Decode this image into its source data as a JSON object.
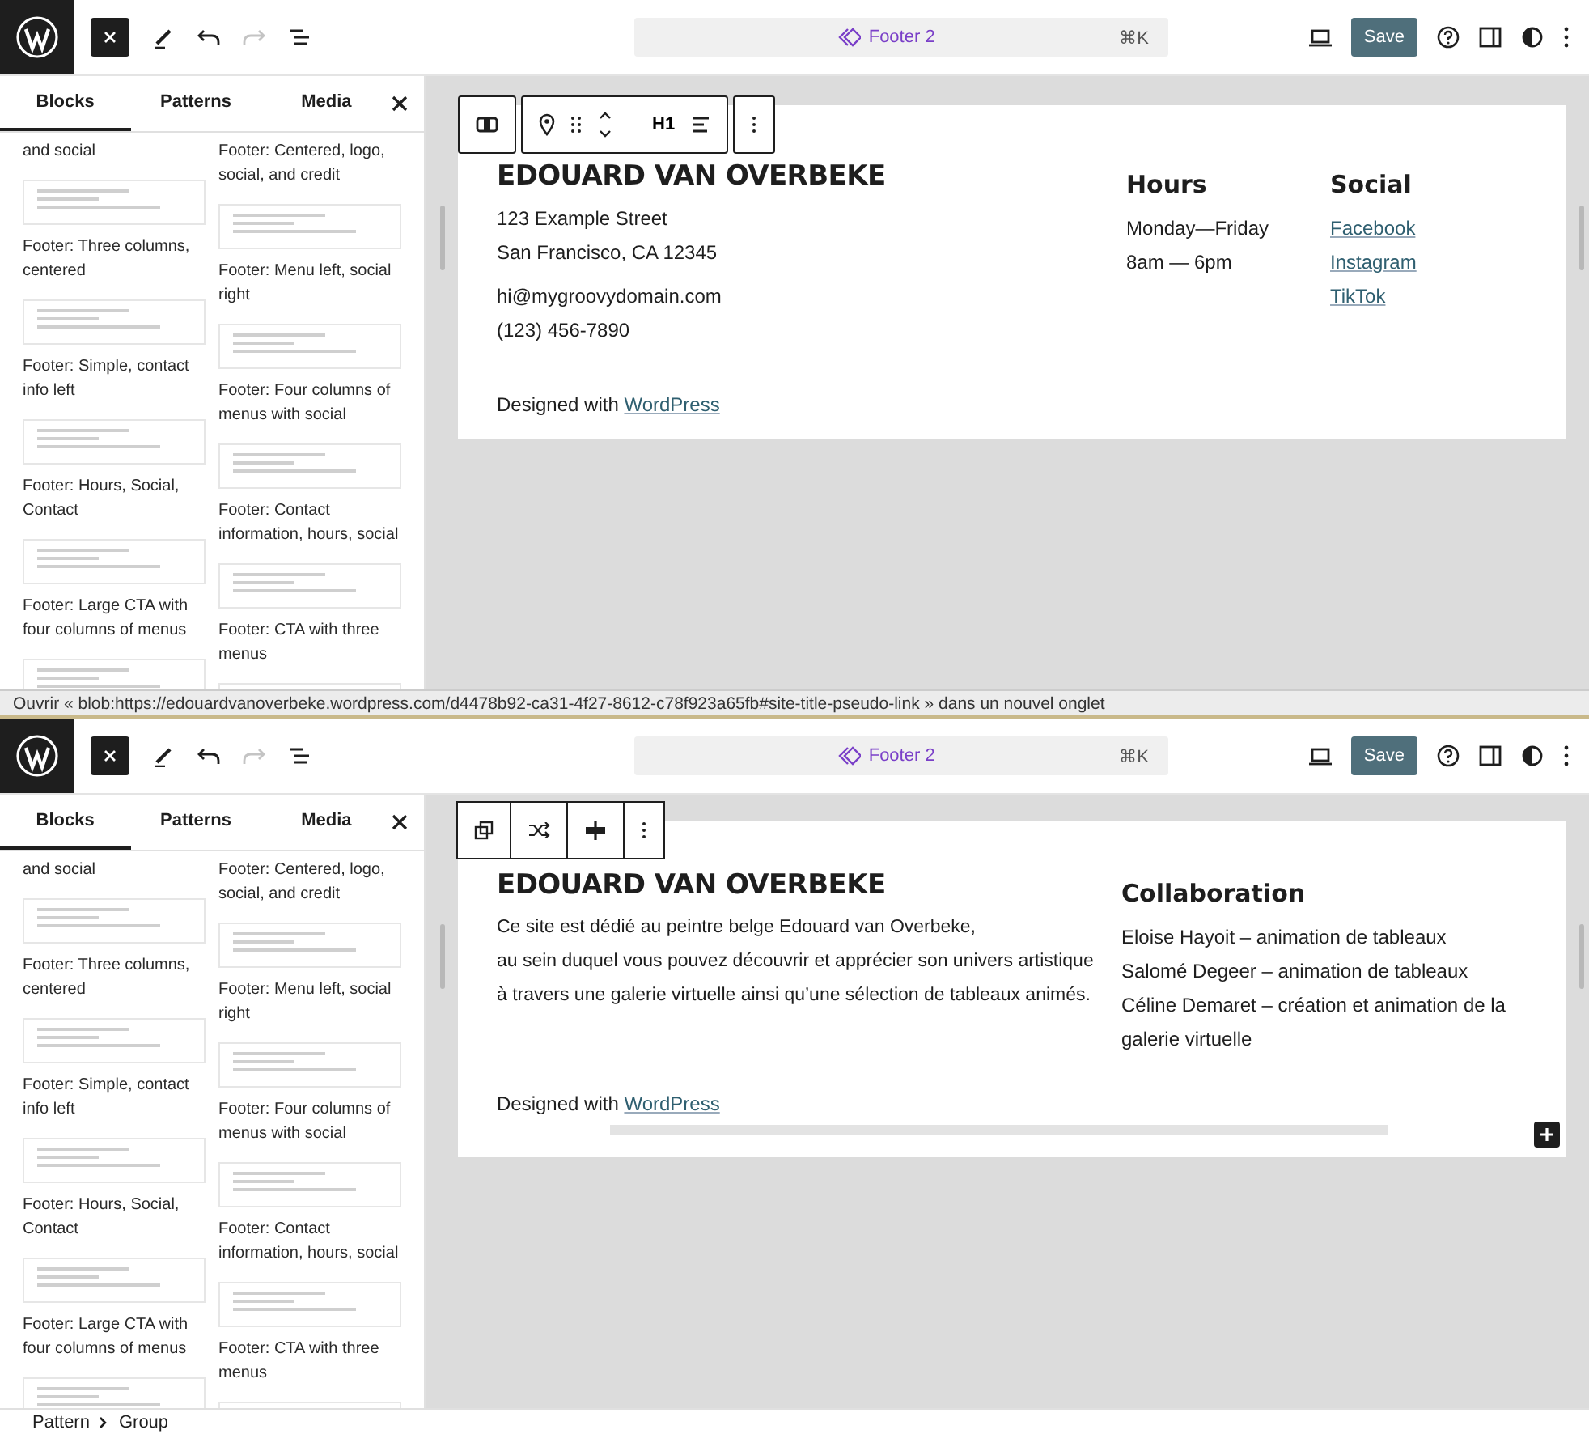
{
  "editors": [
    {
      "header": {
        "command_title": "Footer 2",
        "shortcut": "⌘K",
        "save": "Save",
        "redo_disabled": true
      },
      "inserter": {
        "tabs": [
          {
            "label": "Blocks",
            "selected": true
          },
          {
            "label": "Patterns",
            "selected": false
          },
          {
            "label": "Media",
            "selected": false
          }
        ],
        "columns": [
          [
            {
              "kind": "caption",
              "label": "and social"
            },
            {
              "kind": "pattern",
              "label": "Footer: Three columns, centered"
            },
            {
              "kind": "pattern",
              "label": "Footer: Simple, contact info left"
            },
            {
              "kind": "pattern",
              "label": "Footer: Hours, Social, Contact"
            },
            {
              "kind": "pattern",
              "label": "Footer: Large CTA with four columns of menus"
            },
            {
              "kind": "preview"
            }
          ],
          [
            {
              "kind": "caption",
              "label": "Footer: Centered, logo, social, and credit"
            },
            {
              "kind": "pattern",
              "label": "Footer: Menu left, social right"
            },
            {
              "kind": "pattern",
              "label": "Footer: Four columns of menus with social"
            },
            {
              "kind": "pattern",
              "label": "Footer: Contact information, hours, social"
            },
            {
              "kind": "pattern",
              "label": "Footer: CTA with three menus"
            },
            {
              "kind": "preview"
            }
          ]
        ]
      },
      "canvas": {
        "kind": "heading",
        "heading_level": "H1",
        "title": "EDOUARD VAN OVERBEKE",
        "left_groups": [
          [
            "123 Example Street",
            "San Francisco, CA 12345"
          ],
          [
            "hi@mygroovydomain.com",
            "(123) 456-7890"
          ]
        ],
        "columns": [
          {
            "heading": "Hours",
            "items": [
              {
                "text": "Monday—Friday",
                "link": false
              },
              {
                "text": "8am — 6pm",
                "link": false
              }
            ]
          },
          {
            "heading": "Social",
            "items": [
              {
                "text": "Facebook",
                "link": true
              },
              {
                "text": "Instagram",
                "link": true
              },
              {
                "text": "TikTok",
                "link": true
              }
            ]
          }
        ],
        "credit": {
          "text": "Designed with",
          "link": "WordPress"
        }
      }
    },
    {
      "header": {
        "command_title": "Footer 2",
        "shortcut": "⌘K",
        "save": "Save",
        "redo_disabled": true
      },
      "inserter": {
        "tabs": [
          {
            "label": "Blocks",
            "selected": true
          },
          {
            "label": "Patterns",
            "selected": false
          },
          {
            "label": "Media",
            "selected": false
          }
        ],
        "columns": [
          [
            {
              "kind": "caption",
              "label": "and social"
            },
            {
              "kind": "pattern",
              "label": "Footer: Three columns, centered"
            },
            {
              "kind": "pattern",
              "label": "Footer: Simple, contact info left"
            },
            {
              "kind": "pattern",
              "label": "Footer: Hours, Social, Contact"
            },
            {
              "kind": "pattern",
              "label": "Footer: Large CTA with four columns of menus"
            },
            {
              "kind": "preview"
            }
          ],
          [
            {
              "kind": "caption",
              "label": "Footer: Centered, logo, social, and credit"
            },
            {
              "kind": "pattern",
              "label": "Footer: Menu left, social right"
            },
            {
              "kind": "pattern",
              "label": "Footer: Four columns of menus with social"
            },
            {
              "kind": "pattern",
              "label": "Footer: Contact information, hours, social"
            },
            {
              "kind": "pattern",
              "label": "Footer: CTA with three menus"
            },
            {
              "kind": "preview"
            }
          ]
        ]
      },
      "canvas": {
        "kind": "group",
        "title": "EDOUARD VAN OVERBEKE",
        "left_groups": [
          [
            "Ce site est dédié au peintre belge Edouard van Overbeke,",
            "au sein duquel vous pouvez découvrir et apprécier son univers artistique",
            "à travers une galerie virtuelle ainsi qu’une sélection de tableaux animés."
          ]
        ],
        "columns": [
          {
            "heading": "Collaboration",
            "items": [
              {
                "text": "Eloise Hayoit – animation de tableaux",
                "link": false
              },
              {
                "text": "Salomé Degeer – animation de tableaux",
                "link": false
              },
              {
                "text": "Céline Demaret – création et animation de la galerie virtuelle",
                "link": false
              }
            ]
          }
        ],
        "credit": {
          "text": "Designed with",
          "link": "WordPress"
        }
      }
    }
  ],
  "link_tooltip": "Ouvrir « blob:https://edouardvanoverbeke.wordpress.com/d4478b92-ca31-4f27-8612-c78f923a65fb#site-title-pseudo-link » dans un nouvel onglet",
  "breadcrumb": [
    "Pattern",
    "Group"
  ]
}
